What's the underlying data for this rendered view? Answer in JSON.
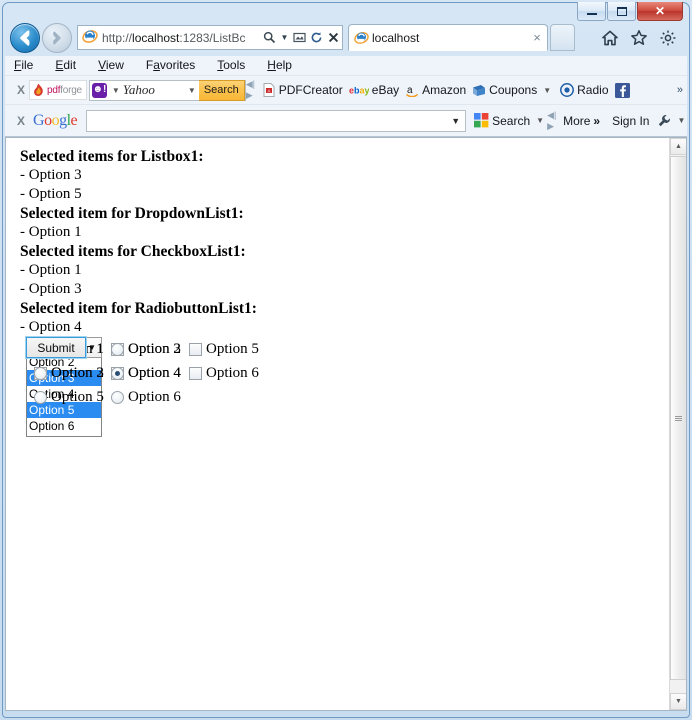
{
  "window": {
    "controls": {
      "minimize": "Minimize",
      "maximize": "Restore",
      "close": "Close"
    }
  },
  "browser": {
    "back_label": "Back",
    "forward_label": "Forward",
    "address": {
      "url_prefix": "http://",
      "url_host": "localhost",
      "url_rest": ":1283/ListBc",
      "full_url": "http://localhost:1283/ListBc"
    },
    "address_icons": [
      "search-icon",
      "dropdown-icon",
      "compatibility-view-icon",
      "refresh-icon",
      "stop-icon"
    ],
    "tab": {
      "title": "localhost",
      "close": "×"
    },
    "new_tab_label": "",
    "tool_icons": [
      "home-icon",
      "favorites-icon",
      "tools-gear-icon"
    ]
  },
  "menubar": {
    "items": [
      {
        "pre": "",
        "key": "F",
        "post": "ile"
      },
      {
        "pre": "",
        "key": "E",
        "post": "dit"
      },
      {
        "pre": "",
        "key": "V",
        "post": "iew"
      },
      {
        "pre": "F",
        "key": "a",
        "post": "vorites"
      },
      {
        "pre": "",
        "key": "T",
        "post": "ools"
      },
      {
        "pre": "",
        "key": "H",
        "post": "elp"
      }
    ]
  },
  "toolbar_yahoo": {
    "close_label": "X",
    "brand": {
      "dark": "pdf",
      "light": "forge"
    },
    "badge": "!",
    "provider": "Yahoo",
    "search_button": "Search",
    "links": [
      {
        "label": "PDFCreator",
        "icon": "pdf-icon",
        "caret": false
      },
      {
        "label": "eBay",
        "icon": "ebay-icon",
        "caret": false
      },
      {
        "label": "Amazon",
        "icon": "amazon-icon",
        "caret": false
      },
      {
        "label": "Coupons",
        "icon": "coupons-icon",
        "caret": true
      },
      {
        "label": "Radio",
        "icon": "radio-icon",
        "caret": false
      },
      {
        "label": "",
        "icon": "facebook-icon",
        "caret": false
      }
    ],
    "overflow": "»"
  },
  "toolbar_google": {
    "close_label": "X",
    "logo": [
      {
        "ch": "G",
        "color": "#3c6fd4"
      },
      {
        "ch": "o",
        "color": "#e0392c"
      },
      {
        "ch": "o",
        "color": "#f5bd24"
      },
      {
        "ch": "g",
        "color": "#3c6fd4"
      },
      {
        "ch": "l",
        "color": "#2aa34a"
      },
      {
        "ch": "e",
        "color": "#e0392c"
      }
    ],
    "input_value": "",
    "input_placeholder": "",
    "search_label": "Search",
    "more_label": "More",
    "more_chevrons": "»",
    "signin_label": "Sign In",
    "settings_icon": "wrench-icon"
  },
  "page": {
    "results": [
      {
        "heading": "Selected items for Listbox1:",
        "items": [
          "- Option 3",
          "- Option 5"
        ]
      },
      {
        "heading": "Selected item for DropdownList1:",
        "items": [
          "- Option 1"
        ]
      },
      {
        "heading": "Selected items for CheckboxList1:",
        "items": [
          "- Option 1",
          "- Option 3"
        ]
      },
      {
        "heading": "Selected item for RadiobuttonList1:",
        "items": [
          "- Option 4"
        ]
      }
    ],
    "listbox": {
      "name": "Listbox1",
      "options": [
        {
          "label": "Option 1",
          "selected": false
        },
        {
          "label": "Option 2",
          "selected": false
        },
        {
          "label": "Option 3",
          "selected": true
        },
        {
          "label": "Option 4",
          "selected": false
        },
        {
          "label": "Option 5",
          "selected": true
        },
        {
          "label": "Option 6",
          "selected": false
        }
      ],
      "selection_color": "#2a8cf0"
    },
    "dropdown": {
      "name": "DropdownList1",
      "value": "Option 1",
      "options": [
        "Option 1",
        "Option 2",
        "Option 3",
        "Option 4",
        "Option 5",
        "Option 6"
      ]
    },
    "checkboxlist": {
      "name": "CheckboxList1",
      "columns": [
        [
          {
            "label": "Option 1",
            "checked": true
          },
          {
            "label": "Option 2",
            "checked": false
          }
        ],
        [
          {
            "label": "Option 3",
            "checked": true
          },
          {
            "label": "Option 4",
            "checked": false
          }
        ],
        [
          {
            "label": "Option 5",
            "checked": false
          },
          {
            "label": "Option 6",
            "checked": false
          }
        ]
      ]
    },
    "radiolist": {
      "name": "RadiobuttonList1",
      "rows": [
        [
          {
            "label": "Option 1",
            "checked": false
          },
          {
            "label": "Option 2",
            "checked": false
          }
        ],
        [
          {
            "label": "Option 3",
            "checked": false
          },
          {
            "label": "Option 4",
            "checked": true
          }
        ],
        [
          {
            "label": "Option 5",
            "checked": false
          },
          {
            "label": "Option 6",
            "checked": false
          }
        ]
      ]
    },
    "submit_label": "Submit"
  },
  "scrollbar": {
    "up": "▲",
    "down": "▼"
  }
}
